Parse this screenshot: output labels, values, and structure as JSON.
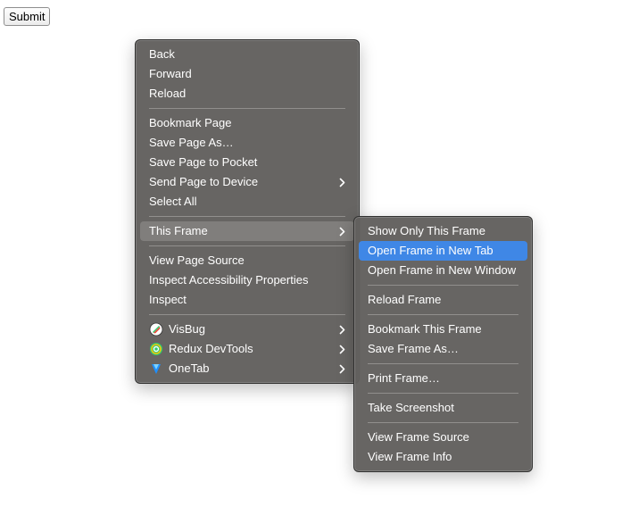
{
  "page": {
    "submit_label": "Submit"
  },
  "context_menu": {
    "items": {
      "back": "Back",
      "forward": "Forward",
      "reload": "Reload",
      "bookmark_page": "Bookmark Page",
      "save_page_as": "Save Page As…",
      "save_to_pocket": "Save Page to Pocket",
      "send_to_device": "Send Page to Device",
      "select_all": "Select All",
      "this_frame": "This Frame",
      "view_page_source": "View Page Source",
      "inspect_accessibility": "Inspect Accessibility Properties",
      "inspect": "Inspect",
      "visbug": "VisBug",
      "redux_devtools": "Redux DevTools",
      "onetab": "OneTab"
    }
  },
  "frame_submenu": {
    "items": {
      "show_only_this_frame": "Show Only This Frame",
      "open_frame_new_tab": "Open Frame in New Tab",
      "open_frame_new_window": "Open Frame in New Window",
      "reload_frame": "Reload Frame",
      "bookmark_this_frame": "Bookmark This Frame",
      "save_frame_as": "Save Frame As…",
      "print_frame": "Print Frame…",
      "take_screenshot": "Take Screenshot",
      "view_frame_source": "View Frame Source",
      "view_frame_info": "View Frame Info"
    }
  },
  "colors": {
    "menu_bg": "#62605e",
    "highlight": "#3f87e6",
    "hover": "#7b7977",
    "text": "#ffffff"
  },
  "icons": {
    "submenu_arrow": "chevron-right-icon",
    "visbug": "visbug-icon",
    "redux_devtools": "redux-devtools-icon",
    "onetab": "onetab-icon"
  }
}
